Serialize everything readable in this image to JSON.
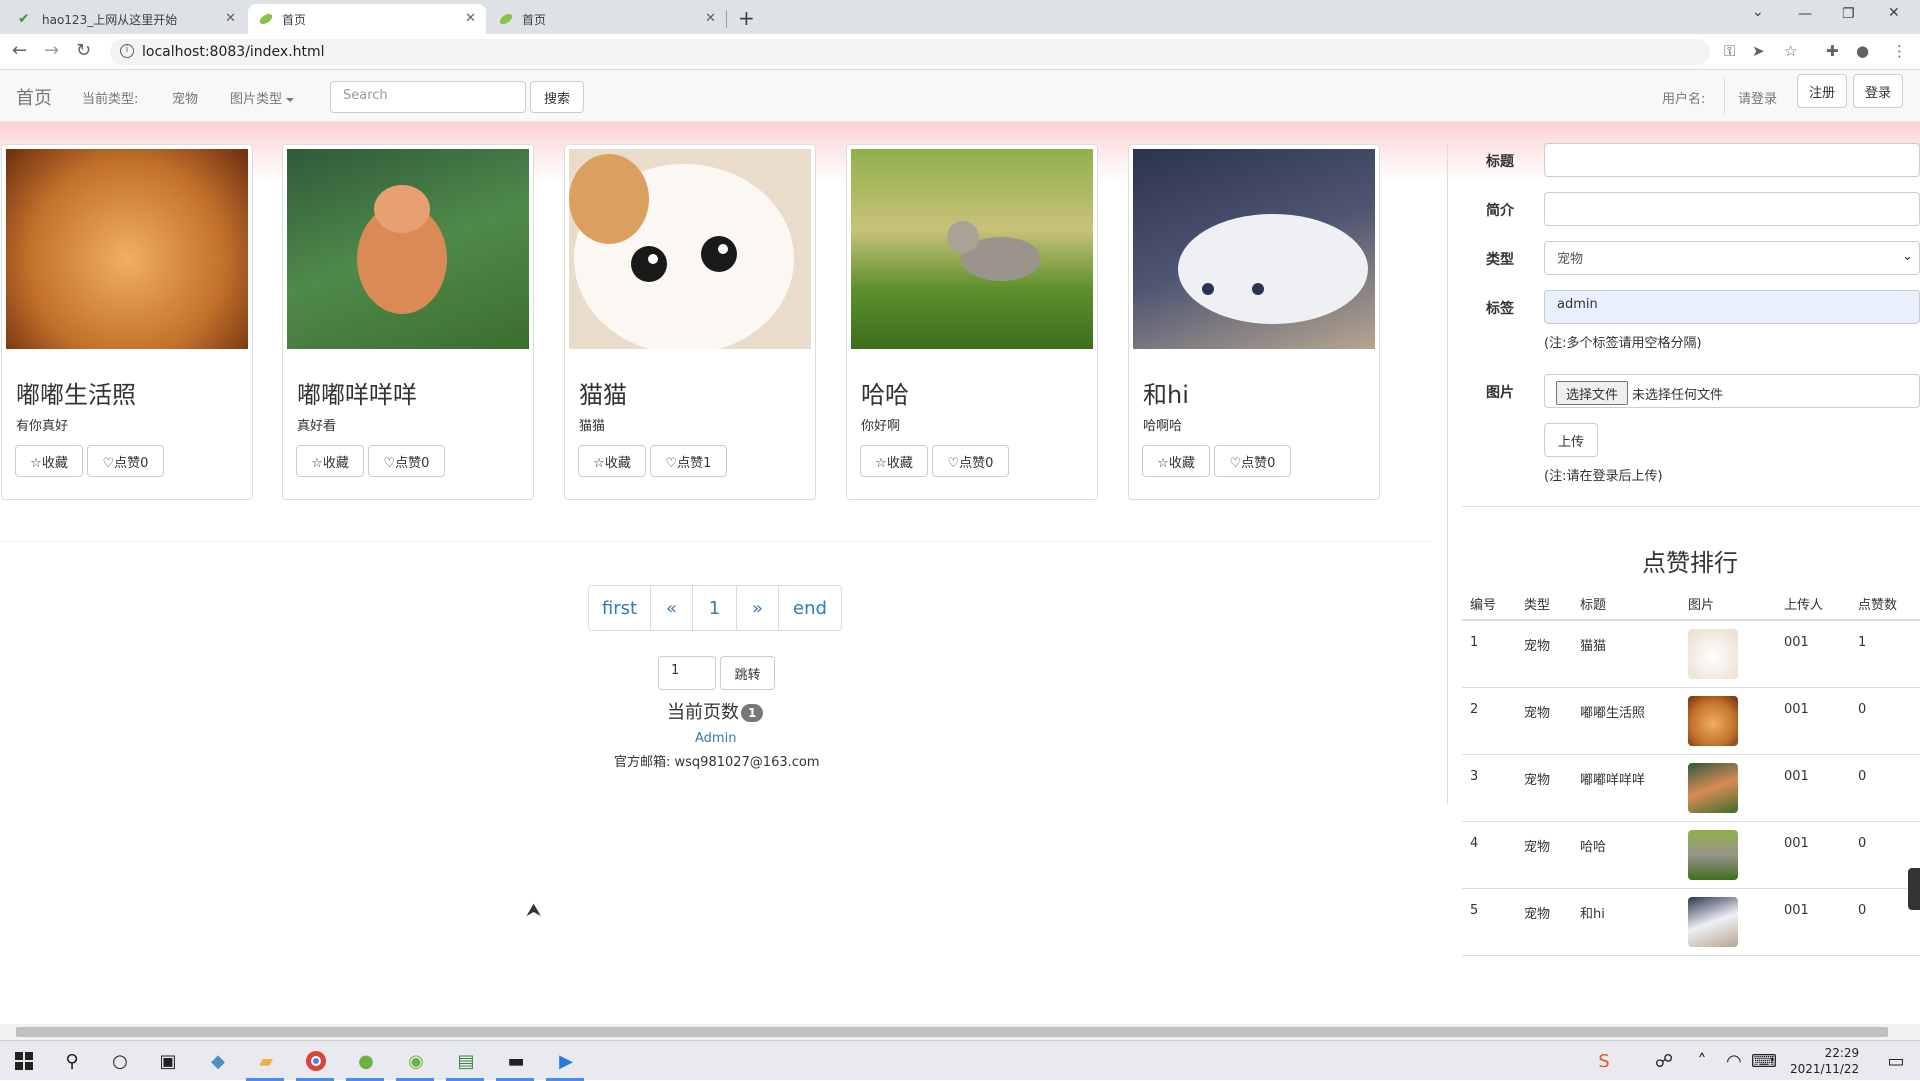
{
  "browser": {
    "tabs": [
      {
        "title": "hao123_上网从这里开始",
        "active": false
      },
      {
        "title": "首页",
        "active": true
      },
      {
        "title": "首页",
        "active": false
      }
    ],
    "url": "localhost:8083/index.html"
  },
  "navbar": {
    "brand": "首页",
    "current_type_label": "当前类型:",
    "current_type_value": "宠物",
    "image_type_dropdown": "图片类型",
    "search_placeholder": "Search",
    "search_button": "搜索",
    "username_label": "用户名:",
    "login_hint": "请登录",
    "register_button": "注册",
    "login_button": "登录"
  },
  "cards": [
    {
      "title": "嘟嘟生活照",
      "desc": "有你真好",
      "fav": "☆收藏",
      "like": "♡点赞0",
      "color": "#d08a3e"
    },
    {
      "title": "嘟嘟咩咩咩",
      "desc": "真好看",
      "fav": "☆收藏",
      "like": "♡点赞0",
      "color": "#4f8a4a"
    },
    {
      "title": "猫猫",
      "desc": "猫猫",
      "fav": "☆收藏",
      "like": "♡点赞1",
      "color": "#e9dccb"
    },
    {
      "title": "哈哈",
      "desc": "你好啊",
      "fav": "☆收藏",
      "like": "♡点赞0",
      "color": "#7aa24a"
    },
    {
      "title": "和hi",
      "desc": "哈啊哈",
      "fav": "☆收藏",
      "like": "♡点赞0",
      "color": "#6d7487"
    }
  ],
  "pagination": {
    "first": "first",
    "prev": "«",
    "page": "1",
    "next": "»",
    "end": "end",
    "jump_value": "1",
    "jump_button": "跳转",
    "current_page_label": "当前页数",
    "current_page_value": "1"
  },
  "footer": {
    "admin": "Admin",
    "email": "官方邮箱: wsq981027@163.com"
  },
  "form": {
    "title_label": "标题",
    "title_value": "",
    "intro_label": "简介",
    "intro_value": "",
    "type_label": "类型",
    "type_value": "宠物",
    "tag_label": "标签",
    "tag_value": "admin",
    "tag_note": "(注:多个标签请用空格分隔)",
    "image_label": "图片",
    "file_button": "选择文件",
    "file_status": "未选择任何文件",
    "upload_button": "上传",
    "upload_note": "(注:请在登录后上传)"
  },
  "ranking": {
    "title": "点赞排行",
    "headers": [
      "编号",
      "类型",
      "标题",
      "图片",
      "上传人",
      "点赞数"
    ],
    "rows": [
      {
        "no": "1",
        "type": "宠物",
        "title": "猫猫",
        "uploader": "001",
        "likes": "1",
        "color": "#e9dccb"
      },
      {
        "no": "2",
        "type": "宠物",
        "title": "嘟嘟生活照",
        "uploader": "001",
        "likes": "0",
        "color": "#d08a3e"
      },
      {
        "no": "3",
        "type": "宠物",
        "title": "嘟嘟咩咩咩",
        "uploader": "001",
        "likes": "0",
        "color": "#4f8a4a"
      },
      {
        "no": "4",
        "type": "宠物",
        "title": "哈哈",
        "uploader": "001",
        "likes": "0",
        "color": "#7aa24a"
      },
      {
        "no": "5",
        "type": "宠物",
        "title": "和hi",
        "uploader": "001",
        "likes": "0",
        "color": "#6d7487"
      }
    ]
  },
  "taskbar": {
    "time": "22:29",
    "date": "2021/11/22"
  }
}
